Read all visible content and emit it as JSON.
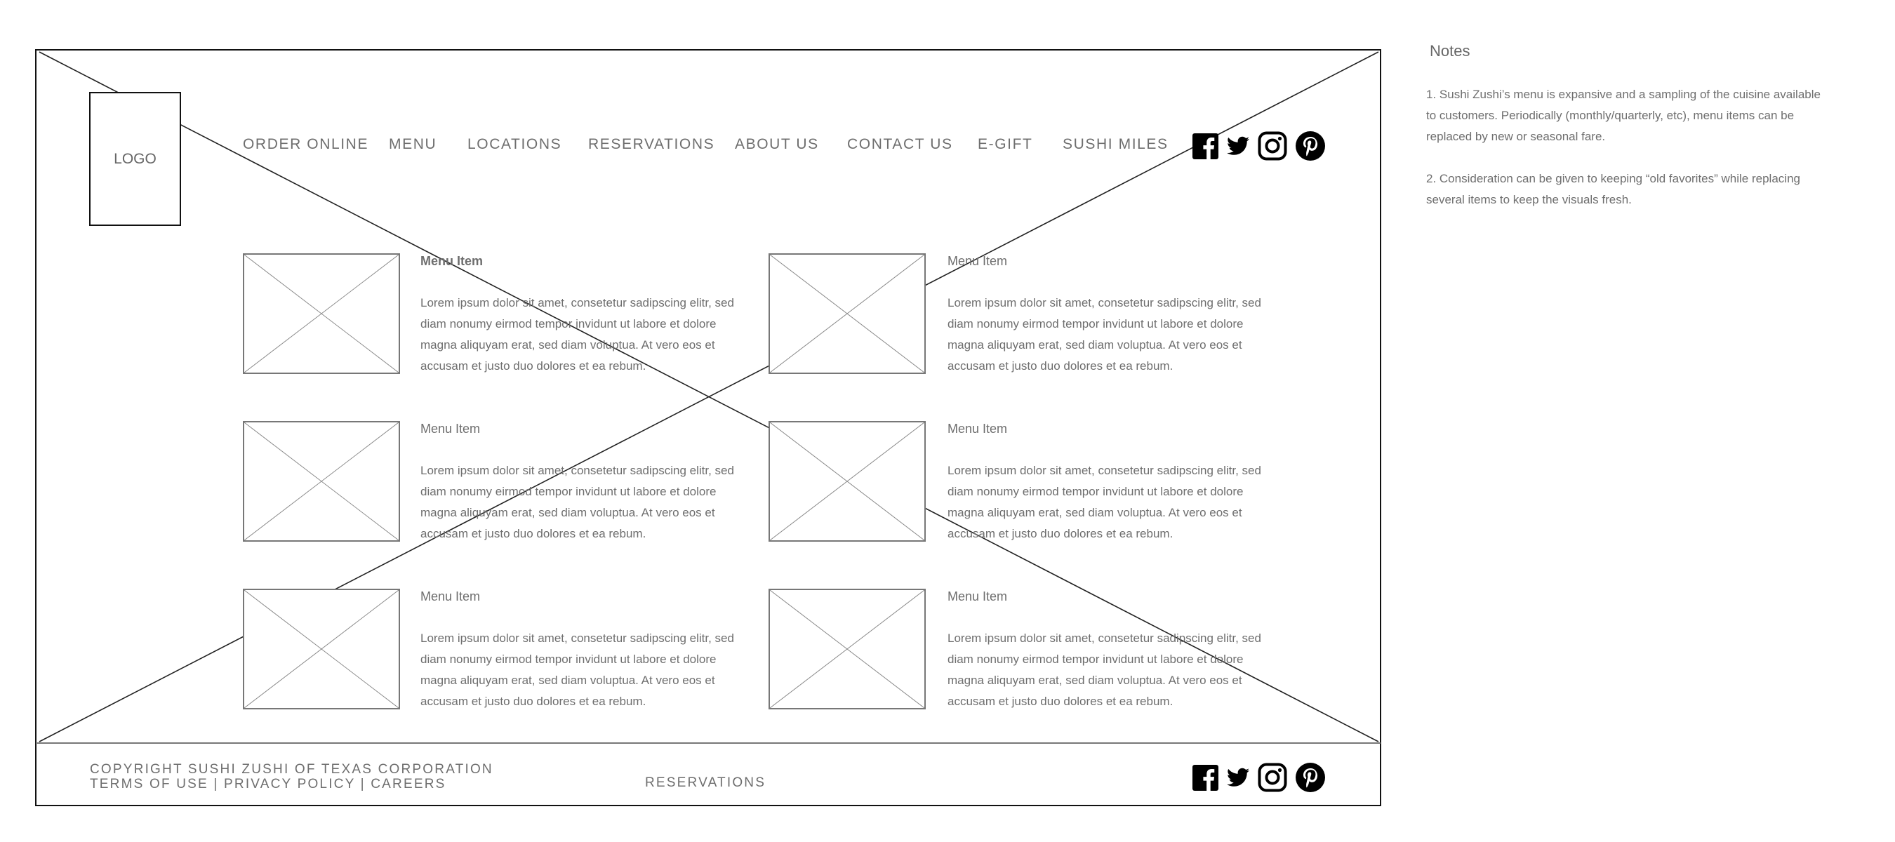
{
  "logo": {
    "label": "LOGO"
  },
  "nav": {
    "items": [
      {
        "label": "ORDER ONLINE"
      },
      {
        "label": "MENU"
      },
      {
        "label": "LOCATIONS"
      },
      {
        "label": "RESERVATIONS"
      },
      {
        "label": "ABOUT US"
      },
      {
        "label": "CONTACT US"
      },
      {
        "label": "E-GIFT"
      },
      {
        "label": "SUSHI MILES"
      }
    ]
  },
  "social": [
    "facebook-icon",
    "twitter-icon",
    "instagram-icon",
    "pinterest-icon"
  ],
  "menu_items": [
    {
      "title": "Menu Item",
      "description": "Lorem ipsum dolor sit amet, consetetur sadipscing elitr, sed diam nonumy eirmod tempor invidunt ut labore et dolore magna aliquyam erat, sed diam voluptua. At vero eos et accusam et justo duo dolores et ea rebum."
    },
    {
      "title": "Menu Item",
      "description": "Lorem ipsum dolor sit amet, consetetur sadipscing elitr, sed diam nonumy eirmod tempor invidunt ut labore et dolore magna aliquyam erat, sed diam voluptua. At vero eos et accusam et justo duo dolores et ea rebum."
    },
    {
      "title": "Menu Item",
      "description": "Lorem ipsum dolor sit amet, consetetur sadipscing elitr, sed diam nonumy eirmod tempor invidunt ut labore et dolore magna aliquyam erat, sed diam voluptua. At vero eos et accusam et justo duo dolores et ea rebum."
    },
    {
      "title": "Menu Item",
      "description": "Lorem ipsum dolor sit amet, consetetur sadipscing elitr, sed diam nonumy eirmod tempor invidunt ut labore et dolore magna aliquyam erat, sed diam voluptua. At vero eos et accusam et justo duo dolores et ea rebum."
    },
    {
      "title": "Menu Item",
      "description": "Lorem ipsum dolor sit amet, consetetur sadipscing elitr, sed diam nonumy eirmod tempor invidunt ut labore et dolore magna aliquyam erat, sed diam voluptua. At vero eos et accusam et justo duo dolores et ea rebum."
    },
    {
      "title": "Menu Item",
      "description": "Lorem ipsum dolor sit amet, consetetur sadipscing elitr, sed diam nonumy eirmod tempor invidunt ut labore et dolore magna aliquyam erat, sed diam voluptua. At vero eos et accusam et justo duo dolores et ea rebum."
    }
  ],
  "footer": {
    "copyright": "COPYRIGHT SUSHI ZUSHI OF TEXAS CORPORATION",
    "links": {
      "terms": "TERMS OF USE",
      "separator": "|",
      "privacy": "PRIVACY POLICY",
      "careers": "CAREERS"
    },
    "reservations": "RESERVATIONS"
  },
  "notes": {
    "title": "Notes",
    "items": [
      "1.   Sushi Zushi’s menu is expansive and a sampling of the cuisine available to customers. Periodically (monthly/quarterly, etc), menu items can be replaced by new or seasonal fare.",
      "2.    Consideration can be given to keeping “old favorites” while replacing several items to keep the visuals fresh."
    ]
  }
}
